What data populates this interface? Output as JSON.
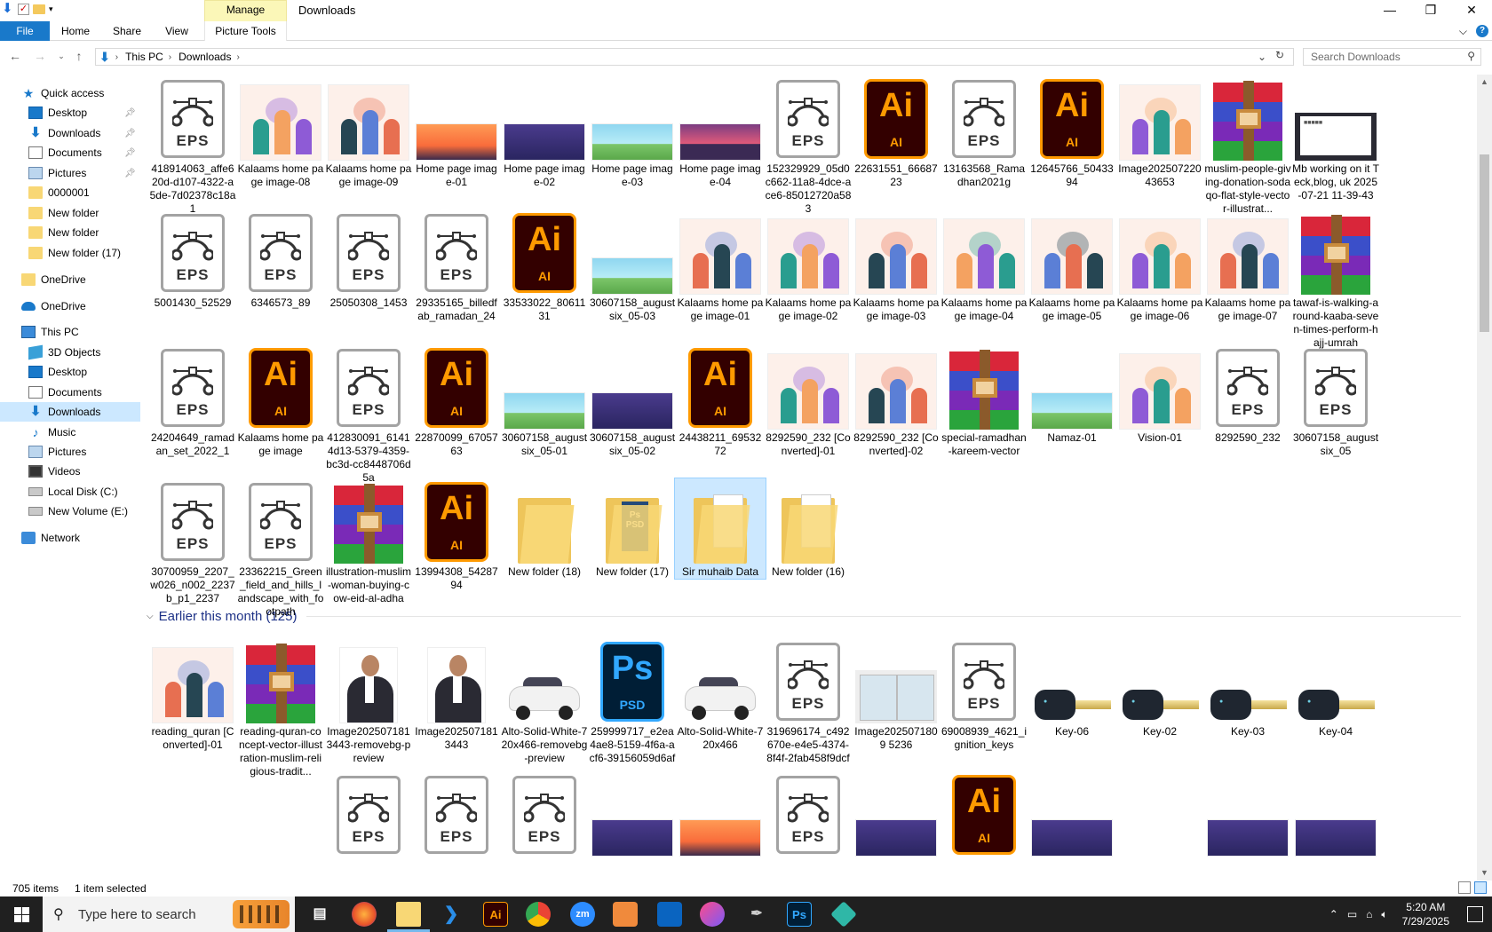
{
  "titlebar": {
    "title": "Downloads",
    "context_tab": "Manage",
    "minimize": "—",
    "maximize": "❐",
    "close": "✕"
  },
  "ribbon": {
    "tabs": [
      "File",
      "Home",
      "Share",
      "View",
      "Picture Tools"
    ],
    "collapse": "⌵",
    "help": "?"
  },
  "address": {
    "breadcrumb": [
      "This PC",
      "Downloads"
    ],
    "search_placeholder": "Search Downloads"
  },
  "nav": {
    "items": [
      {
        "label": "Quick access",
        "icon": "star-icon"
      },
      {
        "label": "Desktop",
        "icon": "desktop-icon",
        "pinned": true
      },
      {
        "label": "Downloads",
        "icon": "download-icon",
        "pinned": true
      },
      {
        "label": "Documents",
        "icon": "documents-icon",
        "pinned": true
      },
      {
        "label": "Pictures",
        "icon": "pictures-icon",
        "pinned": true
      },
      {
        "label": "0000001",
        "icon": "folder-icon"
      },
      {
        "label": "New folder",
        "icon": "folder-icon"
      },
      {
        "label": "New folder",
        "icon": "folder-icon"
      },
      {
        "label": "New folder (17)",
        "icon": "folder-icon"
      },
      {
        "label": "OneDrive",
        "icon": "folder-icon"
      },
      {
        "label": "OneDrive",
        "icon": "cloud-icon"
      },
      {
        "label": "This PC",
        "icon": "computer-icon"
      },
      {
        "label": "3D Objects",
        "icon": "cube-icon"
      },
      {
        "label": "Desktop",
        "icon": "desktop-icon"
      },
      {
        "label": "Documents",
        "icon": "documents-icon"
      },
      {
        "label": "Downloads",
        "icon": "download-icon",
        "selected": true
      },
      {
        "label": "Music",
        "icon": "music-icon"
      },
      {
        "label": "Pictures",
        "icon": "pictures-icon"
      },
      {
        "label": "Videos",
        "icon": "video-icon"
      },
      {
        "label": "Local Disk (C:)",
        "icon": "disk-icon"
      },
      {
        "label": "New Volume (E:)",
        "icon": "disk-icon"
      },
      {
        "label": "Network",
        "icon": "network-icon"
      }
    ]
  },
  "files": {
    "row1": [
      {
        "name": "418914063_affe620d-d107-4322-a5de-7d02378c18a1",
        "type": "eps"
      },
      {
        "name": "Kalaams home page image-08",
        "type": "illu"
      },
      {
        "name": "Kalaams home page image-09",
        "type": "illu"
      },
      {
        "name": "Home page image-01",
        "type": "sunset"
      },
      {
        "name": "Home page image-02",
        "type": "night"
      },
      {
        "name": "Home page image-03",
        "type": "green"
      },
      {
        "name": "Home page image-04",
        "type": "purple"
      },
      {
        "name": "152329929_05d0c662-11a8-4dce-ace6-85012720a583",
        "type": "eps"
      },
      {
        "name": "22631551_6668723",
        "type": "ai"
      },
      {
        "name": "13163568_Ramadhan2021g",
        "type": "eps"
      },
      {
        "name": "12645766_5043394",
        "type": "ai"
      },
      {
        "name": "Image20250722043653",
        "type": "illu"
      },
      {
        "name": "muslim-people-giving-donation-sodaqo-flat-style-vector-illustrat...",
        "type": "rar"
      },
      {
        "name": "Mb working on it Teck,blog, uk 2025-07-21 11-39-43",
        "type": "screen"
      }
    ],
    "row2": [
      {
        "name": "5001430_52529",
        "type": "eps"
      },
      {
        "name": "6346573_89",
        "type": "eps"
      },
      {
        "name": "25050308_1453",
        "type": "eps"
      },
      {
        "name": "29335165_billedfab_ramadan_24",
        "type": "eps"
      },
      {
        "name": "33533022_8061131",
        "type": "ai"
      },
      {
        "name": "30607158_augustsix_05-03",
        "type": "green"
      },
      {
        "name": "Kalaams home page image-01",
        "type": "illu"
      },
      {
        "name": "Kalaams home page image-02",
        "type": "illu"
      },
      {
        "name": "Kalaams home page image-03",
        "type": "illu"
      },
      {
        "name": "Kalaams home page image-04",
        "type": "illu"
      },
      {
        "name": "Kalaams home page image-05",
        "type": "illu"
      },
      {
        "name": "Kalaams home page image-06",
        "type": "illu"
      },
      {
        "name": "Kalaams home page image-07",
        "type": "illu"
      },
      {
        "name": "tawaf-is-walking-around-kaaba-seven-times-perform-hajj-umrah",
        "type": "rar"
      }
    ],
    "row3": [
      {
        "name": "24204649_ramadan_set_2022_1",
        "type": "eps"
      },
      {
        "name": "Kalaams home page image",
        "type": "ai"
      },
      {
        "name": "412830091_61414d13-5379-4359-bc3d-cc8448706d5a",
        "type": "eps"
      },
      {
        "name": "22870099_6705763",
        "type": "ai"
      },
      {
        "name": "30607158_augustsix_05-01",
        "type": "green"
      },
      {
        "name": "30607158_augustsix_05-02",
        "type": "night"
      },
      {
        "name": "24438211_6953272",
        "type": "ai"
      },
      {
        "name": "8292590_232 [Converted]-01",
        "type": "illu"
      },
      {
        "name": "8292590_232 [Converted]-02",
        "type": "illu"
      },
      {
        "name": "special-ramadhan-kareem-vector",
        "type": "rar"
      },
      {
        "name": "Namaz-01",
        "type": "green"
      },
      {
        "name": "Vision-01",
        "type": "illu"
      },
      {
        "name": "8292590_232",
        "type": "eps"
      },
      {
        "name": "30607158_augustsix_05",
        "type": "eps"
      }
    ],
    "row4": [
      {
        "name": "30700959_2207_w026_n002_2237b_p1_2237",
        "type": "eps"
      },
      {
        "name": "23362215_Green_field_and_hills_landscape_with_footpath",
        "type": "eps"
      },
      {
        "name": "illustration-muslim-woman-buying-cow-eid-al-adha",
        "type": "rar"
      },
      {
        "name": "13994308_5428794",
        "type": "ai"
      },
      {
        "name": "New folder (18)",
        "type": "folder"
      },
      {
        "name": "New folder (17)",
        "type": "folder-psd"
      },
      {
        "name": "Sir muhaib Data",
        "type": "folder-doc",
        "selected": true
      },
      {
        "name": "New folder (16)",
        "type": "folder-doc"
      }
    ],
    "group_label": "Earlier this month (125)",
    "row5": [
      {
        "name": "reading_quran [Converted]-01",
        "type": "illu"
      },
      {
        "name": "reading-quran-concept-vector-illustration-muslim-religious-tradit...",
        "type": "rar"
      },
      {
        "name": "Image2025071813443-removebg-preview",
        "type": "person"
      },
      {
        "name": "Image2025071813443",
        "type": "person"
      },
      {
        "name": "Alto-Solid-White-720x466-removebg-preview",
        "type": "car"
      },
      {
        "name": "259999717_e2ea4ae8-5159-4f6a-acf6-39156059d6af",
        "type": "ps"
      },
      {
        "name": "Alto-Solid-White-720x466",
        "type": "car"
      },
      {
        "name": "319696174_c492670e-e4e5-4374-8f4f-2fab458f9dcf",
        "type": "eps"
      },
      {
        "name": "Image2025071809 5236",
        "type": "doublepic"
      },
      {
        "name": "69008939_4621_ignition_keys",
        "type": "eps"
      },
      {
        "name": "Key-06",
        "type": "key"
      },
      {
        "name": "Key-02",
        "type": "key"
      },
      {
        "name": "Key-03",
        "type": "key"
      },
      {
        "name": "Key-04",
        "type": "key"
      }
    ]
  },
  "status": {
    "count": "705 items",
    "selected": "1 item selected"
  },
  "taskbar": {
    "search_placeholder": "Type here to search",
    "time": "5:20 AM",
    "date": "7/29/2025",
    "apps": [
      "Ai",
      "Ps",
      "zm"
    ]
  },
  "colors": {
    "accent": "#1979ca",
    "selection": "#cce8ff",
    "ai_orange": "#ff9a00",
    "ps_blue": "#31a8ff",
    "group_header": "#1e3287"
  }
}
